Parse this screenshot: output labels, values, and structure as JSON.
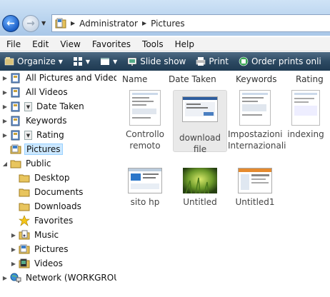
{
  "address": {
    "crumbs": [
      "Administrator",
      "Pictures"
    ],
    "back_icon": "back-arrow-icon",
    "forward_icon": "forward-arrow-icon"
  },
  "menu": [
    "File",
    "Edit",
    "View",
    "Favorites",
    "Tools",
    "Help"
  ],
  "toolbar": {
    "organize": "Organize",
    "slideshow": "Slide show",
    "print": "Print",
    "order_prints": "Order prints onli"
  },
  "nav": [
    {
      "label": "All Pictures and Videos",
      "icon": "search-folder-icon",
      "expand": "▶"
    },
    {
      "label": "All Videos",
      "icon": "search-folder-icon",
      "expand": "▶"
    },
    {
      "label": "Date Taken",
      "icon": "search-folder-icon",
      "expand": "▶"
    },
    {
      "label": "Keywords",
      "icon": "search-folder-icon",
      "expand": "▶"
    },
    {
      "label": "Rating",
      "icon": "search-folder-icon",
      "expand": "▶"
    },
    {
      "label": "Pictures",
      "icon": "pictures-folder-icon",
      "expand": ""
    },
    {
      "label": "Public",
      "icon": "folder-icon",
      "expand": "◢"
    },
    {
      "label": "Desktop",
      "icon": "folder-icon",
      "expand": ""
    },
    {
      "label": "Documents",
      "icon": "folder-icon",
      "expand": ""
    },
    {
      "label": "Downloads",
      "icon": "folder-icon",
      "expand": ""
    },
    {
      "label": "Favorites",
      "icon": "star-icon",
      "expand": ""
    },
    {
      "label": "Music",
      "icon": "music-folder-icon",
      "expand": "▶"
    },
    {
      "label": "Pictures",
      "icon": "pictures-folder-icon",
      "expand": "▶"
    },
    {
      "label": "Videos",
      "icon": "videos-folder-icon",
      "expand": "▶"
    },
    {
      "label": "Network (WORKGROUP",
      "icon": "network-icon",
      "expand": "▶"
    }
  ],
  "columns": [
    "Name",
    "Date Taken",
    "Keywords",
    "Rating"
  ],
  "files": [
    {
      "name_line1": "Controllo",
      "name_line2": "remoto"
    },
    {
      "name_line1": "download",
      "name_line2": "file"
    },
    {
      "name_line1": "Impostazioni",
      "name_line2": "Internazionali"
    },
    {
      "name_line1": "indexing",
      "name_line2": ""
    },
    {
      "name_line1": "sito hp",
      "name_line2": ""
    },
    {
      "name_line1": "Untitled",
      "name_line2": ""
    },
    {
      "name_line1": "Untitled1",
      "name_line2": ""
    }
  ],
  "colors": {
    "toolbar": "#2d4a63",
    "selection": "#cce8ff",
    "menubar": "#f3f3f3"
  }
}
